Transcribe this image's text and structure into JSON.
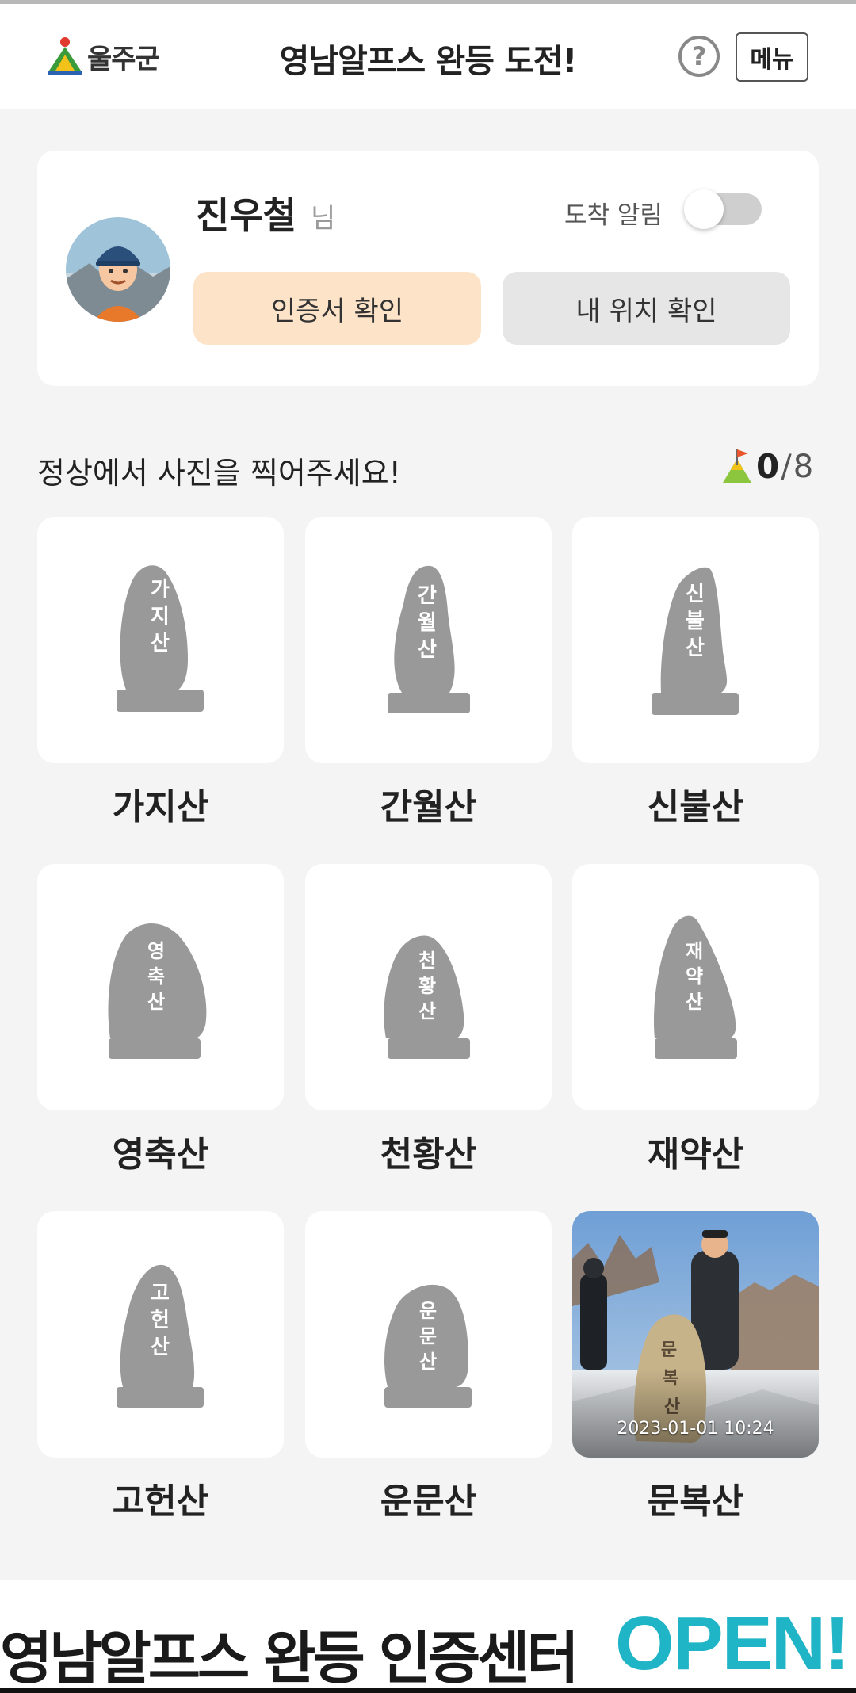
{
  "header": {
    "logo_text": "울주군",
    "title": "영남알프스 완등 도전!",
    "help_label": "?",
    "menu_label": "메뉴"
  },
  "profile": {
    "name": "진우철",
    "suffix": "님",
    "alarm_label": "도착 알림",
    "alarm_on": false,
    "certificate_button": "인증서 확인",
    "location_button": "내 위치 확인"
  },
  "challenge": {
    "instruction": "정상에서 사진을 찍어주세요!",
    "completed": "0",
    "separator": "/",
    "total": "8"
  },
  "mountains": [
    {
      "name": "가지산",
      "stone_text": "가지산",
      "photo": false
    },
    {
      "name": "간월산",
      "stone_text": "간월산",
      "photo": false
    },
    {
      "name": "신불산",
      "stone_text": "신불산",
      "photo": false
    },
    {
      "name": "영축산",
      "stone_text": "영축산",
      "photo": false
    },
    {
      "name": "천황산",
      "stone_text": "천황산",
      "photo": false
    },
    {
      "name": "재약산",
      "stone_text": "재약산",
      "photo": false
    },
    {
      "name": "고헌산",
      "stone_text": "고헌산",
      "photo": false
    },
    {
      "name": "운문산",
      "stone_text": "운문산",
      "photo": false
    },
    {
      "name": "문복산",
      "stone_text": "문복산",
      "photo": true,
      "photo_date": "2023-01-01 10:24"
    }
  ],
  "banner": {
    "text": "영남알프스 완등 인증센터",
    "highlight": "OPEN!"
  },
  "colors": {
    "cert_button": "#fde3c8",
    "location_button": "#e6e6e6",
    "stone": "#999999",
    "banner_accent": "#1fb4c6"
  }
}
